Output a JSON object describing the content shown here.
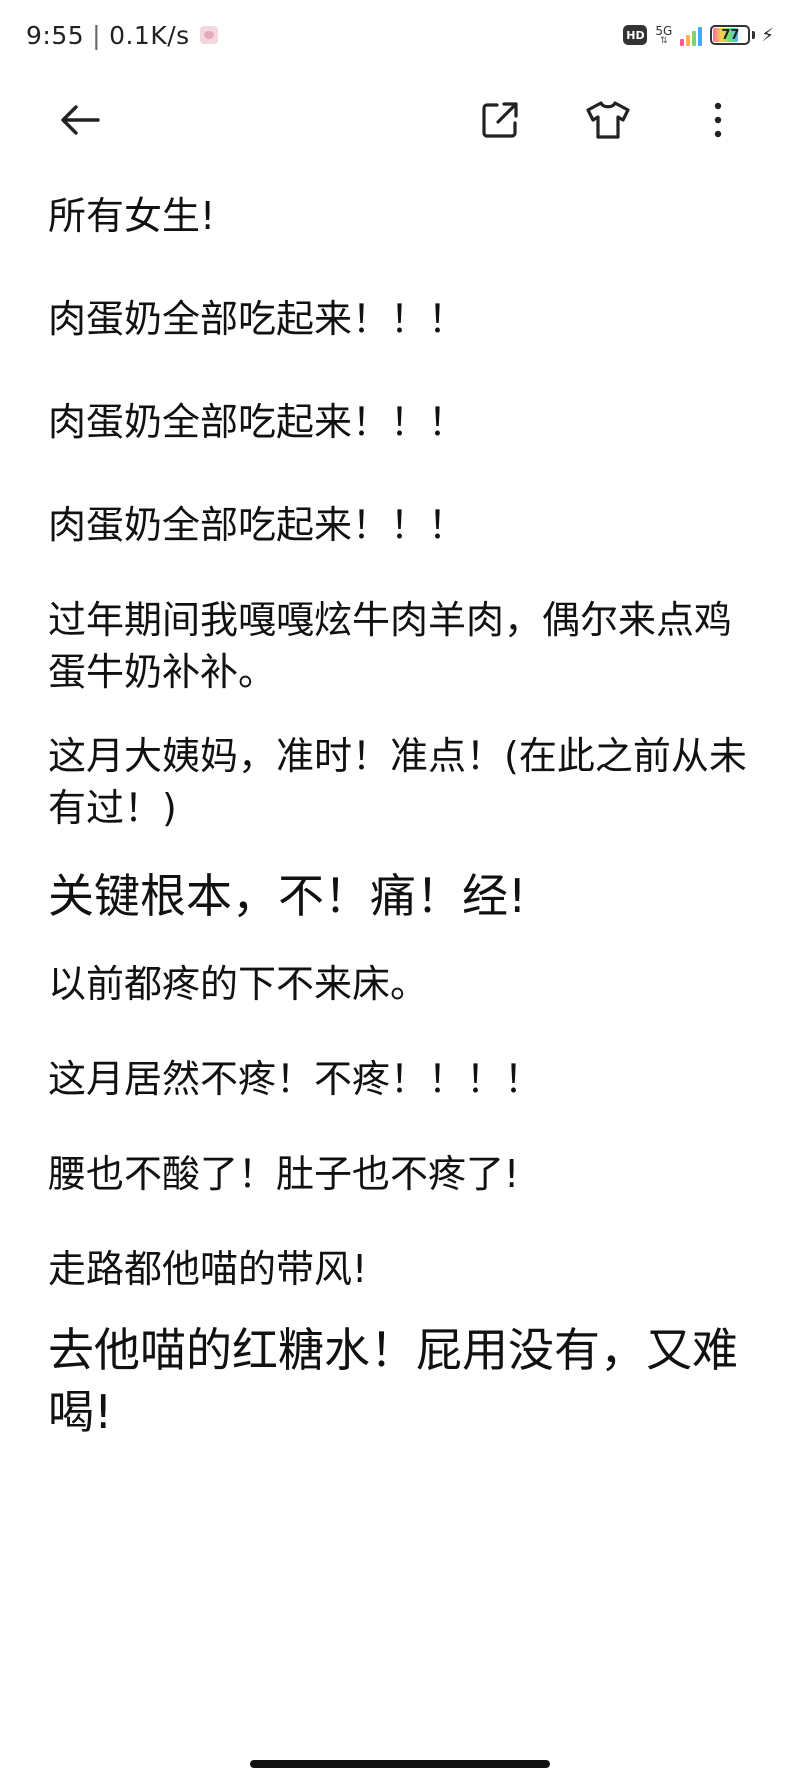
{
  "status_bar": {
    "time": "9:55",
    "separator": "|",
    "speed": "0.1K/s",
    "network_label": "5G",
    "network_arrows": "⇅",
    "hd_label": "HD",
    "battery_level": "77",
    "battery_fraction": 0.77
  },
  "toolbar": {
    "back_icon": "arrow-left-icon",
    "share_icon": "share-external-icon",
    "shirt_icon": "t-shirt-icon",
    "more_icon": "more-vertical-icon"
  },
  "colors": {
    "text": "#111111",
    "background": "#ffffff",
    "signal_bars": [
      "#ff5a8a",
      "#ffb347",
      "#7fd36b",
      "#3fa9ff"
    ]
  },
  "content": {
    "paragraphs": [
      {
        "text": "所有女生!",
        "size": "normal"
      },
      {
        "text": "肉蛋奶全部吃起来！！！",
        "size": "normal"
      },
      {
        "text": "肉蛋奶全部吃起来！！！",
        "size": "normal"
      },
      {
        "text": "肉蛋奶全部吃起来！！！",
        "size": "normal"
      },
      {
        "text": "过年期间我嘎嘎炫牛肉羊肉，偶尔来点鸡蛋牛奶补补。",
        "size": "normal"
      },
      {
        "text": "这月大姨妈，准时！准点！(在此之前从未有过！)",
        "size": "normal"
      },
      {
        "text": "关键根本，不！痛！经!",
        "size": "large"
      },
      {
        "text": "以前都疼的下不来床。",
        "size": "normal"
      },
      {
        "text": "这月居然不疼！不疼！！！！",
        "size": "normal"
      },
      {
        "text": "腰也不酸了！肚子也不疼了!",
        "size": "normal"
      },
      {
        "text": "走路都他喵的带风!",
        "size": "normal"
      },
      {
        "text": "去他喵的红糖水！屁用没有，又难喝!",
        "size": "large"
      }
    ]
  }
}
